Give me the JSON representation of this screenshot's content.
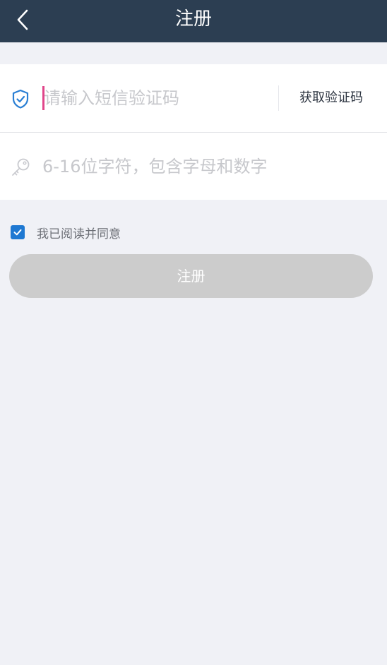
{
  "header": {
    "title": "注册",
    "back_icon": "chevron-left-icon"
  },
  "form": {
    "sms_code": {
      "icon": "shield-check-icon",
      "placeholder": "请输入短信验证码",
      "value": ""
    },
    "get_code_label": "获取验证码",
    "password": {
      "icon": "key-icon",
      "placeholder": "6-16位字符，包含字母和数字",
      "value": ""
    }
  },
  "agreement": {
    "checked": true,
    "label": "我已阅读并同意"
  },
  "submit_label": "注册",
  "colors": {
    "header_bg": "#2c3e52",
    "page_bg": "#f0f1f6",
    "accent": "#1e78d2",
    "cursor": "#e0458a",
    "button_disabled": "#cccccc"
  }
}
